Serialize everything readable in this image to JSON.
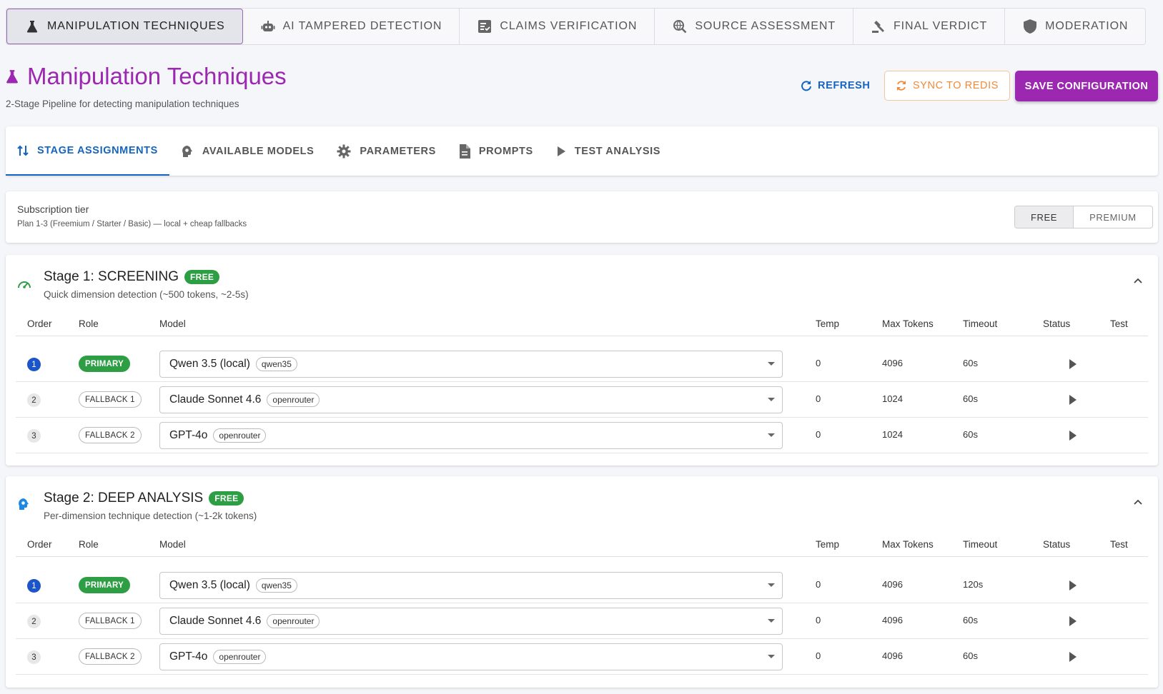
{
  "top_tabs": [
    {
      "label": "Manipulation Techniques",
      "icon": "flask-icon"
    },
    {
      "label": "AI Tampered Detection",
      "icon": "robot-icon"
    },
    {
      "label": "Claims Verification",
      "icon": "checklist-icon"
    },
    {
      "label": "Source Assessment",
      "icon": "search-globe-icon"
    },
    {
      "label": "Final Verdict",
      "icon": "gavel-icon"
    },
    {
      "label": "Moderation",
      "icon": "shield-icon"
    }
  ],
  "header": {
    "title": "Manipulation Techniques",
    "subtitle": "2-Stage Pipeline for detecting manipulation techniques",
    "refresh_label": "Refresh",
    "sync_label": "Sync to Redis",
    "save_label": "Save Configuration"
  },
  "sub_tabs": [
    {
      "label": "Stage Assignments",
      "icon": "swap-vertical-icon"
    },
    {
      "label": "Available Models",
      "icon": "brain-icon"
    },
    {
      "label": "Parameters",
      "icon": "gear-icon"
    },
    {
      "label": "Prompts",
      "icon": "document-icon"
    },
    {
      "label": "Test Analysis",
      "icon": "play-icon"
    }
  ],
  "subscription": {
    "label": "Subscription tier",
    "description": "Plan 1-3 (Freemium / Starter / Basic) — local + cheap fallbacks",
    "options": [
      "Free",
      "Premium"
    ],
    "selected": "Free"
  },
  "columns": [
    "Order",
    "Role",
    "Model",
    "Temp",
    "Max Tokens",
    "Timeout",
    "Status",
    "Test"
  ],
  "stages": [
    {
      "title": "Stage 1: SCREENING",
      "badge": "FREE",
      "description": "Quick dimension detection (~500 tokens, ~2-5s)",
      "icon": "speedometer-icon",
      "icon_color": "#2e9e45",
      "rows": [
        {
          "order": "1",
          "role": "PRIMARY",
          "model": "Qwen 3.5 (local)",
          "provider": "qwen35",
          "temp": "0",
          "max_tokens": "4096",
          "timeout": "60s"
        },
        {
          "order": "2",
          "role": "FALLBACK 1",
          "model": "Claude Sonnet 4.6",
          "provider": "openrouter",
          "temp": "0",
          "max_tokens": "1024",
          "timeout": "60s"
        },
        {
          "order": "3",
          "role": "FALLBACK 2",
          "model": "GPT-4o",
          "provider": "openrouter",
          "temp": "0",
          "max_tokens": "1024",
          "timeout": "60s"
        }
      ]
    },
    {
      "title": "Stage 2: DEEP ANALYSIS",
      "badge": "FREE",
      "description": "Per-dimension technique detection (~1-2k tokens)",
      "icon": "brain-icon",
      "icon_color": "#1e88e5",
      "rows": [
        {
          "order": "1",
          "role": "PRIMARY",
          "model": "Qwen 3.5 (local)",
          "provider": "qwen35",
          "temp": "0",
          "max_tokens": "4096",
          "timeout": "120s"
        },
        {
          "order": "2",
          "role": "FALLBACK 1",
          "model": "Claude Sonnet 4.6",
          "provider": "openrouter",
          "temp": "0",
          "max_tokens": "4096",
          "timeout": "60s"
        },
        {
          "order": "3",
          "role": "FALLBACK 2",
          "model": "GPT-4o",
          "provider": "openrouter",
          "temp": "0",
          "max_tokens": "4096",
          "timeout": "60s"
        }
      ]
    }
  ],
  "colors": {
    "accent": "#9c27b0",
    "primary_blue": "#1565c0",
    "success": "#2e9e45",
    "sync_orange": "#f08a3a"
  }
}
